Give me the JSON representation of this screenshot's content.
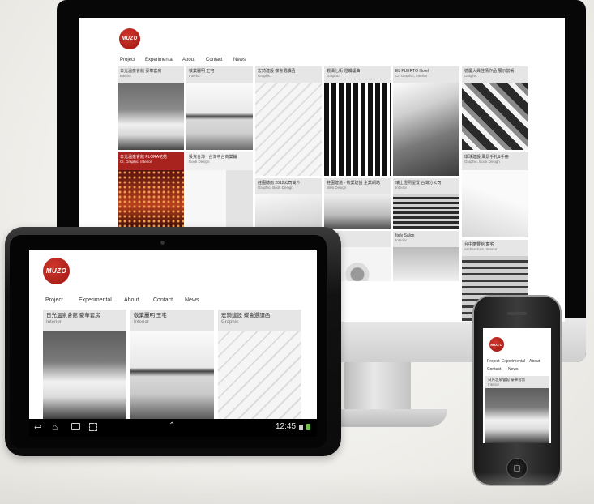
{
  "site": {
    "logo_text": "MUZO",
    "nav": [
      "Project",
      "Experimental",
      "About",
      "Contact",
      "News"
    ]
  },
  "monitor": {
    "tiles": [
      {
        "title": "日光溫泉會館 豪華套房",
        "category": "Interior"
      },
      {
        "title": "敬業麗明 王宅",
        "category": "Interior"
      },
      {
        "title": "宏錡建設 蝶會選讀函",
        "category": "Graphic"
      },
      {
        "title": "觀濤七街 燈觸緩曲",
        "category": "Graphic"
      },
      {
        "title": "EL PUERTO Hotel",
        "category": "CI, Graphic, Interior"
      },
      {
        "title": "德慶大員住情作品 展示當帳",
        "category": "Graphic"
      },
      {
        "title": "日光溫泉會館 FLORA花苑",
        "category": "CI, Graphic, Interior"
      },
      {
        "title": "投資台灣 - 台灣中台商業鋪",
        "category": "Book Design"
      },
      {
        "title": "莊園聽雨 2012公司簡介",
        "category": "Graphic, Book Design"
      },
      {
        "title": "莊園建造 - 敬業建設 企業網站",
        "category": "Web Design"
      },
      {
        "title": "瑞士燈照屋置 台灣分公司",
        "category": "Interior"
      },
      {
        "title": "環球建設 風景手札&手冊",
        "category": "Graphic, Book Design"
      },
      {
        "title": "台中摩豐館 寓宅",
        "category": "Architecture, Interior"
      },
      {
        "title": "Itely Salon",
        "category": "Interior"
      },
      {
        "title": "漾會館",
        "category": ""
      }
    ]
  },
  "tablet": {
    "tiles": [
      {
        "title": "日光溫泉會館 豪華套房",
        "category": "Interior"
      },
      {
        "title": "敬業麗明 王宅",
        "category": "Interior"
      },
      {
        "title": "宏錡建設 蝶會選讀函",
        "category": "Graphic"
      }
    ],
    "clock": "12:45"
  },
  "phone": {
    "tile": {
      "title": "日光溫泉會館 豪華套房",
      "category": "Interior"
    }
  },
  "colors": {
    "brand_red": "#a8231d",
    "tile_bg": "#e6e6e6"
  }
}
